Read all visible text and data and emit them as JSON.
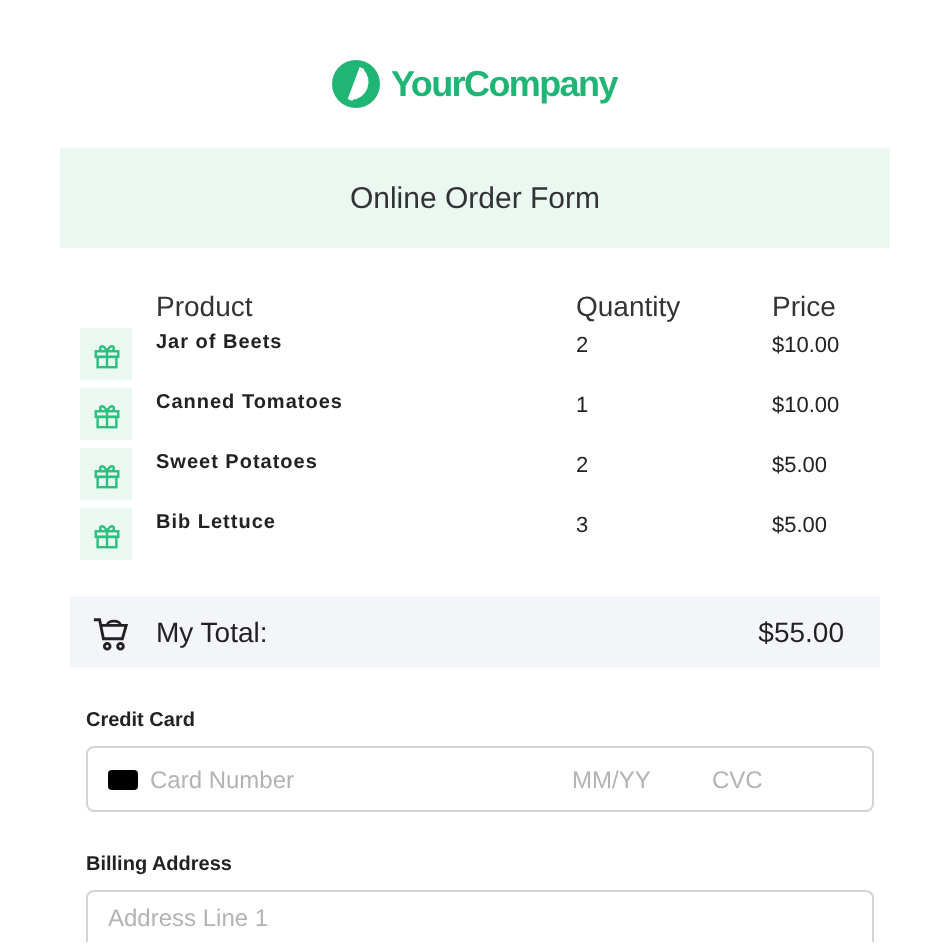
{
  "logo": {
    "text": "YourCompany"
  },
  "header": {
    "title": "Online Order Form"
  },
  "table": {
    "columns": [
      "Product",
      "Quantity",
      "Price"
    ],
    "rows": [
      {
        "product": "Jar of Beets",
        "quantity": "2",
        "price": "$10.00"
      },
      {
        "product": "Canned Tomatoes",
        "quantity": "1",
        "price": "$10.00"
      },
      {
        "product": "Sweet Potatoes",
        "quantity": "2",
        "price": "$5.00"
      },
      {
        "product": "Bib Lettuce",
        "quantity": "3",
        "price": "$5.00"
      }
    ]
  },
  "total": {
    "label": "My Total:",
    "amount": "$55.00"
  },
  "credit_card": {
    "label": "Credit Card",
    "number_placeholder": "Card Number",
    "expiry_placeholder": "MM/YY",
    "cvc_placeholder": "CVC"
  },
  "billing": {
    "label": "Billing Address",
    "placeholder": "Address Line 1"
  }
}
